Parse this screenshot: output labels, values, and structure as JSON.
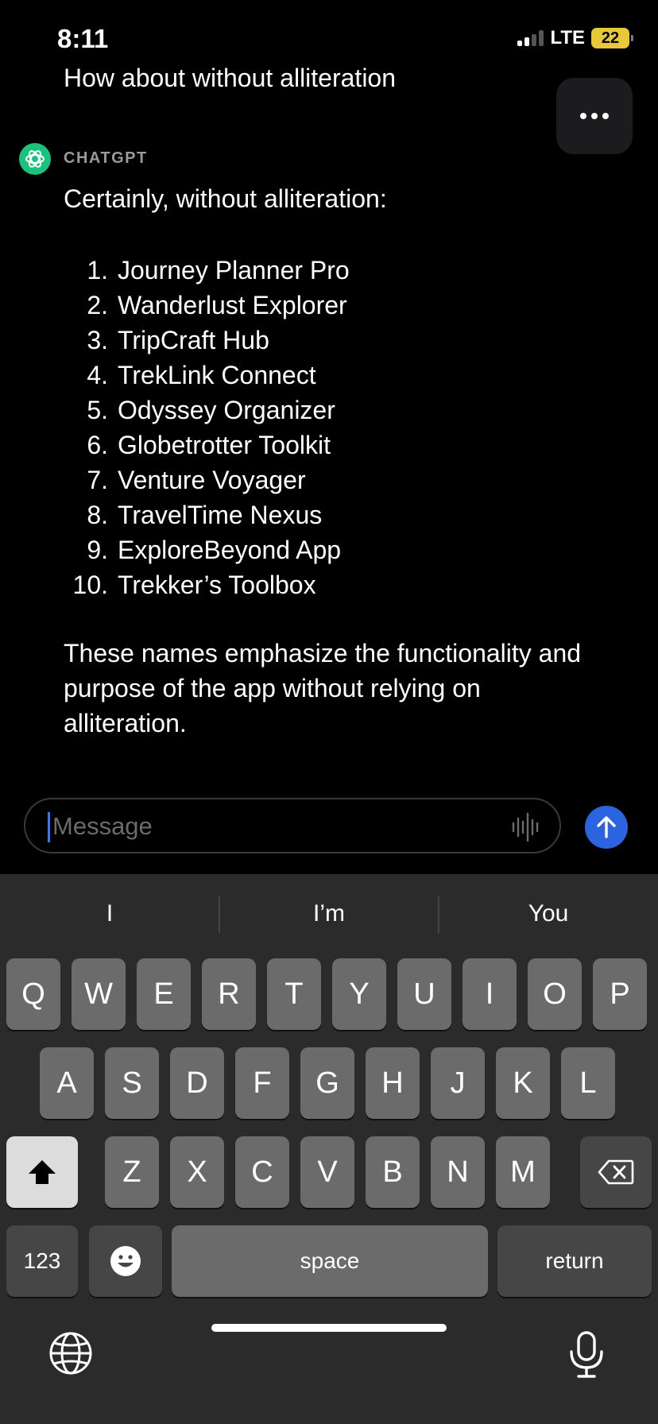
{
  "status": {
    "time": "8:11",
    "network": "LTE",
    "battery": "22"
  },
  "chat": {
    "user_message": "How about without alliteration",
    "assistant_name": "CHATGPT",
    "intro": "Certainly, without alliteration:",
    "items": [
      {
        "num": "1.",
        "text": "Journey Planner Pro"
      },
      {
        "num": "2.",
        "text": "Wanderlust Explorer"
      },
      {
        "num": "3.",
        "text": "TripCraft Hub"
      },
      {
        "num": "4.",
        "text": "TrekLink Connect"
      },
      {
        "num": "5.",
        "text": "Odyssey Organizer"
      },
      {
        "num": "6.",
        "text": "Globetrotter Toolkit"
      },
      {
        "num": "7.",
        "text": "Venture Voyager"
      },
      {
        "num": "8.",
        "text": "TravelTime Nexus"
      },
      {
        "num": "9.",
        "text": "ExploreBeyond App"
      },
      {
        "num": "10.",
        "text": "Trekker’s Toolbox"
      }
    ],
    "outro": "These names emphasize the functionality and purpose of the app without relying on alliteration."
  },
  "composer": {
    "placeholder": "Message",
    "value": ""
  },
  "keyboard": {
    "suggestions": [
      "I",
      "I’m",
      "You"
    ],
    "row1": [
      "Q",
      "W",
      "E",
      "R",
      "T",
      "Y",
      "U",
      "I",
      "O",
      "P"
    ],
    "row2": [
      "A",
      "S",
      "D",
      "F",
      "G",
      "H",
      "J",
      "K",
      "L"
    ],
    "row3": [
      "Z",
      "X",
      "C",
      "V",
      "B",
      "N",
      "M"
    ],
    "numbers_label": "123",
    "space_label": "space",
    "return_label": "return"
  },
  "colors": {
    "accent": "#2a64e0",
    "battery": "#e7c937",
    "avatar": "#19c37d"
  }
}
